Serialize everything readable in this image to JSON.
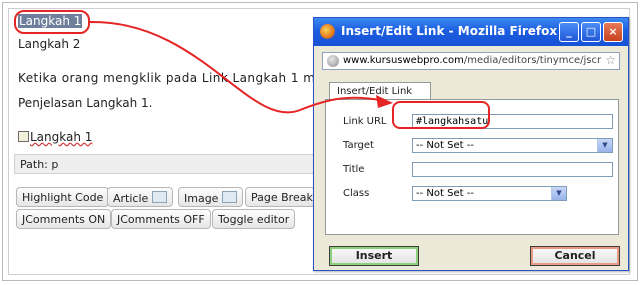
{
  "editor": {
    "lines": [
      "Langkah 1",
      "Langkah 2",
      "Ketika orang mengklik pada Link Langkah 1 mak",
      "Penjelasan Langkah 1.",
      "Langkah 1"
    ],
    "path": "Path: p",
    "buttons_row1": [
      "Highlight Code",
      "Article",
      "Image",
      "Page Break"
    ],
    "buttons_row2": [
      "JComments ON",
      "JComments OFF",
      "Toggle editor"
    ]
  },
  "dialog": {
    "title": "Insert/Edit Link - Mozilla Firefox",
    "url_host": "www.kursuswebpro.com",
    "url_path": "/media/editors/tinymce/jscr",
    "tab": "Insert/Edit Link",
    "fields": {
      "link_url_label": "Link URL",
      "link_url_value": "#langkahsatu",
      "target_label": "Target",
      "target_value": "-- Not Set --",
      "title_label": "Title",
      "title_value": "",
      "class_label": "Class",
      "class_value": "-- Not Set --"
    },
    "insert_label": "Insert",
    "cancel_label": "Cancel",
    "win_buttons": [
      "_",
      "□",
      "×"
    ]
  },
  "colors": {
    "annotation_red": "#e52525",
    "titlebar_blue": "#1c5ee0",
    "selection": "#6f7f9b"
  }
}
